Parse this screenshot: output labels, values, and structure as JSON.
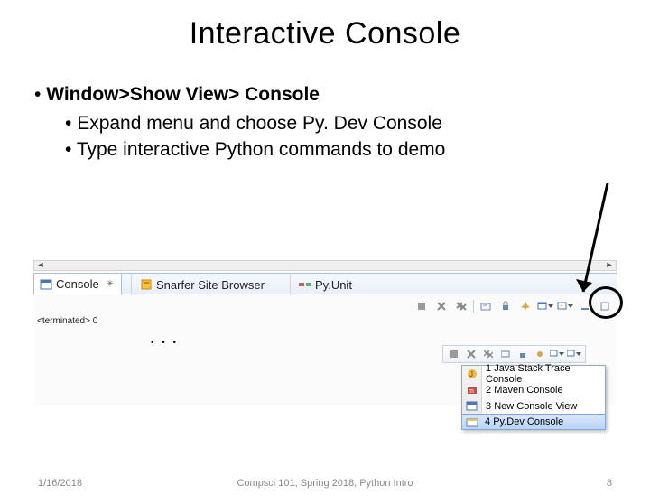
{
  "title": "Interactive Console",
  "bullets": {
    "main": "Window>Show View> Console",
    "sub1": "Expand menu and choose Py. Dev Console",
    "sub2": "Type interactive Python commands to demo"
  },
  "tabs": {
    "console": "Console",
    "snarfer": "Snarfer Site Browser",
    "pyunit": "Py.Unit"
  },
  "terminated": "<terminated> 0",
  "menu": {
    "items": [
      {
        "num": "1",
        "label": "Java Stack Trace Console"
      },
      {
        "num": "2",
        "label": "Maven Console"
      },
      {
        "num": "3",
        "label": "New Console View"
      },
      {
        "num": "4",
        "label": "Py.Dev Console"
      }
    ],
    "selected_index": 3
  },
  "icons": {
    "console": "console-icon",
    "snarfer": "snarfer-icon",
    "pyunit": "pyunit-icon",
    "java": "java-icon",
    "maven": "maven-icon",
    "newview": "window-icon",
    "pydev": "pydev-icon"
  },
  "footer": {
    "date": "1/16/2018",
    "center": "Compsci 101, Spring 2018, Python Intro",
    "page": "8"
  },
  "colors": {
    "tabbar": "#e8effa",
    "menu_sel": "#c8ddf8"
  }
}
